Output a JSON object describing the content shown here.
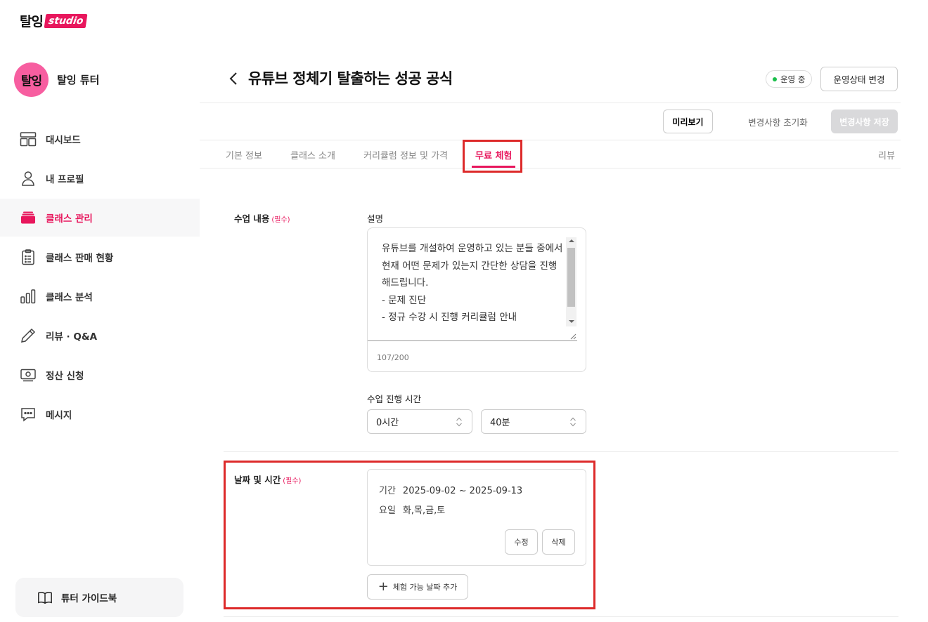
{
  "brand": {
    "logo_main": "탈잉",
    "logo_studio": "studio"
  },
  "profile": {
    "avatar_text": "탈잉",
    "name": "탈잉 튜터"
  },
  "sidebar": {
    "items": [
      {
        "label": "대시보드",
        "icon": "dashboard-icon"
      },
      {
        "label": "내 프로필",
        "icon": "user-icon"
      },
      {
        "label": "클래스 관리",
        "icon": "class-stack-icon",
        "active": true
      },
      {
        "label": "클래스 판매 현황",
        "icon": "clipboard-icon"
      },
      {
        "label": "클래스 분석",
        "icon": "bar-chart-icon"
      },
      {
        "label": "리뷰 · Q&A",
        "icon": "pencil-icon"
      },
      {
        "label": "정산 신청",
        "icon": "money-icon"
      },
      {
        "label": "메시지",
        "icon": "chat-icon"
      }
    ],
    "guide_label": "튜터 가이드북"
  },
  "header": {
    "title": "유튜브 정체기 탈출하는 성공 공식",
    "status": "운영 중",
    "status_color": "#1bbf4b",
    "change_status_label": "운영상태 변경"
  },
  "actions": {
    "preview": "미리보기",
    "reset": "변경사항 초기화",
    "save": "변경사항 저장"
  },
  "tabs": [
    {
      "label": "기본 정보"
    },
    {
      "label": "클래스 소개"
    },
    {
      "label": "커리큘럼 정보 및 가격"
    },
    {
      "label": "무료 체험",
      "active": true
    },
    {
      "label": "리뷰"
    }
  ],
  "form": {
    "content_label": "수업 내용",
    "required": "(필수)",
    "description_label": "설명",
    "description_text": "유튜브를 개설하여 운영하고 있는 분들 중에서 현재 어떤 문제가 있는지 간단한 상담을 진행해드립니다.\n- 문제 진단\n- 정규 수강 시 진행 커리큘럼 안내",
    "char_count": "107/200",
    "duration_label": "수업 진행 시간",
    "hours_value": "0시간",
    "minutes_value": "40분",
    "schedule_label": "날짜 및 시간",
    "period_key": "기간",
    "period_value": "2025-09-02 ~ 2025-09-13",
    "days_key": "요일",
    "days_value": "화,목,금,토",
    "edit_label": "수정",
    "delete_label": "삭제",
    "add_date_label": "체험 가능 날짜 추가"
  },
  "colors": {
    "accent": "#e8175d",
    "highlight": "#dd2a2a"
  }
}
